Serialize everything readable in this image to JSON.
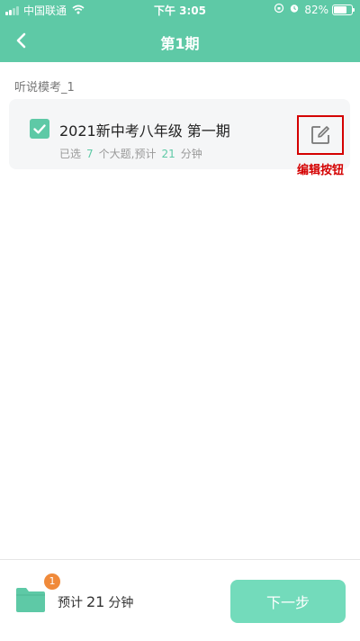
{
  "status_bar": {
    "carrier": "中国联通",
    "time": "下午 3:05",
    "battery": "82%",
    "battery_level": 0.82
  },
  "nav": {
    "title": "第1期"
  },
  "section": {
    "label": "听说模考_1"
  },
  "card": {
    "checked": true,
    "title": "2021新中考八年级 第一期",
    "sub_prefix": "已选",
    "question_count": "7",
    "sub_middle": "个大题,预计",
    "minutes": "21",
    "sub_suffix": "分钟"
  },
  "edit": {
    "caption": "编辑按钮"
  },
  "footer": {
    "badge_count": "1",
    "est_prefix": "预计",
    "est_minutes": "21",
    "est_suffix": "分钟",
    "next_label": "下一步"
  },
  "colors": {
    "accent": "#5ec9a6",
    "annotation_red": "#d40000",
    "badge_orange": "#f08a3a"
  }
}
